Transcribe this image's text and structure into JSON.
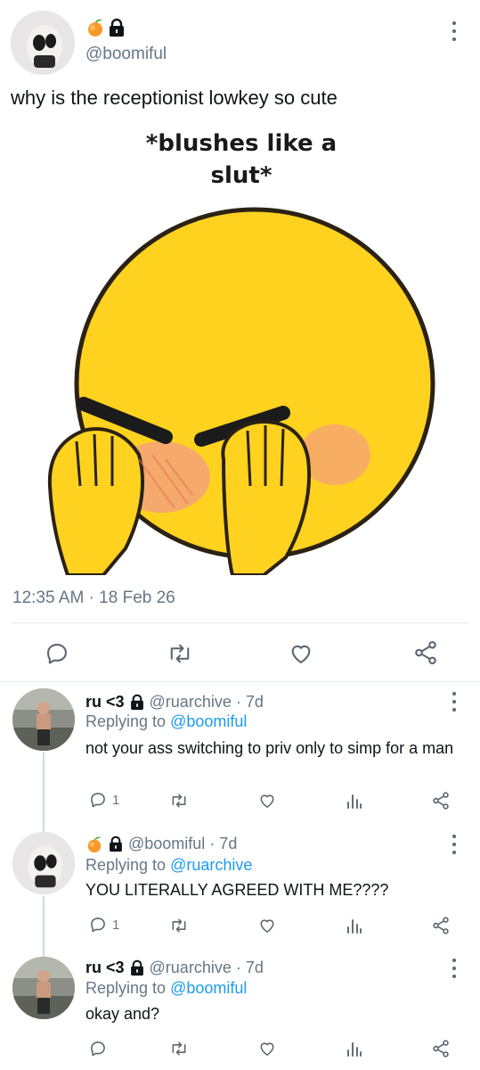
{
  "main_tweet": {
    "handle": "@boomiful",
    "text": "why is the receptionist lowkey so cute",
    "meme_caption": "*blushes like a slut*",
    "timestamp": "12:35 AM",
    "separator": "·",
    "date": "18 Feb 26"
  },
  "replies": [
    {
      "name": "ru <3",
      "handle": "@ruarchive",
      "age": "· 7d",
      "replying_prefix": "Replying to",
      "replying_to": "@boomiful",
      "text": "not your ass switching to priv only to simp for a man",
      "reply_count": "1"
    },
    {
      "handle": "@boomiful",
      "age": "· 7d",
      "replying_prefix": "Replying to",
      "replying_to": "@ruarchive",
      "text": "YOU LITERALLY AGREED WITH ME????",
      "reply_count": "1"
    },
    {
      "name": "ru <3",
      "handle": "@ruarchive",
      "age": "· 7d",
      "replying_prefix": "Replying to",
      "replying_to": "@boomiful",
      "text": "okay and?"
    }
  ],
  "colors": {
    "link": "#1d9bf0",
    "muted": "#657786",
    "emoji_yellow": "#ffd21f",
    "blush": "#f5a27a"
  },
  "icons": [
    "peach-emoji-icon",
    "lock-icon",
    "more-icon",
    "reply-icon",
    "retweet-icon",
    "like-icon",
    "share-icon",
    "analytics-icon"
  ]
}
